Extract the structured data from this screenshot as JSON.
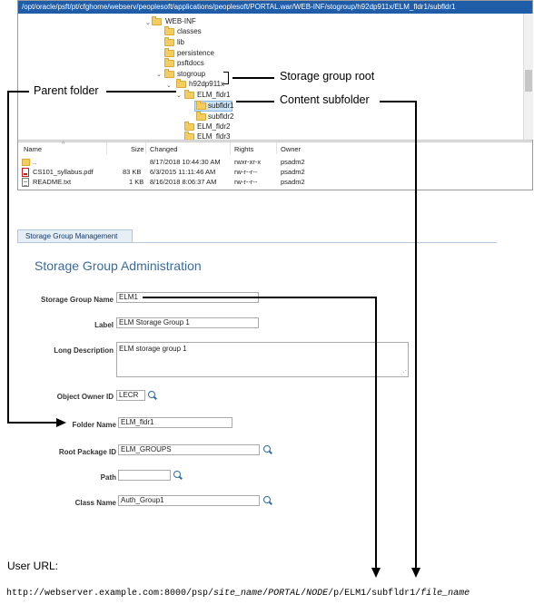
{
  "path_bar": "/opt/oracle/psft/pt/cfghome/webserv/peoplesoft/applications/peoplesoft/PORTAL.war/WEB-INF/stogroup/h92dp911x/ELM_fldr1/subfldr1",
  "tree": {
    "items": [
      "WEB-INF",
      "classes",
      "lib",
      "persistence",
      "psftdocs",
      "stogroup",
      "h92dp911x",
      "ELM_fldr1",
      "subfldr1",
      "subfldr2",
      "ELM_fldr2",
      "ELM_fldr3"
    ]
  },
  "file_list": {
    "headers": {
      "name": "Name",
      "size": "Size",
      "changed": "Changed",
      "rights": "Rights",
      "owner": "Owner"
    },
    "rows": [
      {
        "name": "..",
        "size": "",
        "changed": "8/17/2018 10:44:30 AM",
        "rights": "rwxr-xr-x",
        "owner": "psadm2"
      },
      {
        "name": "CS101_syllabus.pdf",
        "size": "83 KB",
        "changed": "6/3/2015 11:11:46 AM",
        "rights": "rw-r--r--",
        "owner": "psadm2"
      },
      {
        "name": "README.txt",
        "size": "1 KB",
        "changed": "8/16/2018 8:06:37 AM",
        "rights": "rw-r--r--",
        "owner": "psadm2"
      }
    ]
  },
  "tab_label": "Storage Group Management",
  "page_title": "Storage Group Administration",
  "form": {
    "storage_group_name": {
      "label": "Storage Group Name",
      "value": "ELM1"
    },
    "label": {
      "label": "Label",
      "value": "ELM Storage Group 1"
    },
    "long_description": {
      "label": "Long Description",
      "value": "ELM storage group 1"
    },
    "object_owner_id": {
      "label": "Object Owner ID",
      "value": "LECR"
    },
    "folder_name": {
      "label": "Folder Name",
      "value": "ELM_fldr1"
    },
    "root_package_id": {
      "label": "Root Package ID",
      "value": "ELM_GROUPS"
    },
    "path": {
      "label": "Path",
      "value": ""
    },
    "class_name": {
      "label": "Class Name",
      "value": "Auth_Group1"
    }
  },
  "callouts": {
    "storage_group_root": "Storage group root",
    "parent_folder": "Parent folder",
    "content_subfolder": "Content subfolder"
  },
  "user_url_label": "User URL:",
  "url": {
    "p1": "http://webserver.example.com:8000/psp/",
    "p2": "site_name",
    "p3": "/",
    "p4": "PORTAL",
    "p5": "/",
    "p6": "NODE",
    "p7": "/p/ELM1/subfldr1/",
    "p8": "file_name"
  }
}
